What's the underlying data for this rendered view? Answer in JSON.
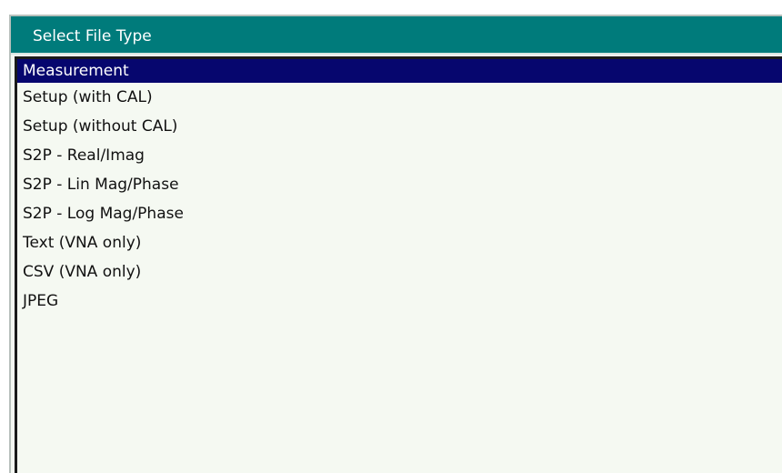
{
  "dialog": {
    "title": "Select File Type"
  },
  "file_types": {
    "selected_index": 0,
    "items": [
      {
        "label": "Measurement"
      },
      {
        "label": "Setup (with CAL)"
      },
      {
        "label": "Setup (without CAL)"
      },
      {
        "label": "S2P - Real/Imag"
      },
      {
        "label": "S2P - Lin Mag/Phase"
      },
      {
        "label": "S2P - Log Mag/Phase"
      },
      {
        "label": "Text (VNA only)"
      },
      {
        "label": "CSV (VNA only)"
      },
      {
        "label": "JPEG"
      }
    ]
  },
  "colors": {
    "title_bar": "#007b7b",
    "selection": "#06066e",
    "list_background": "#f5f9f2"
  }
}
